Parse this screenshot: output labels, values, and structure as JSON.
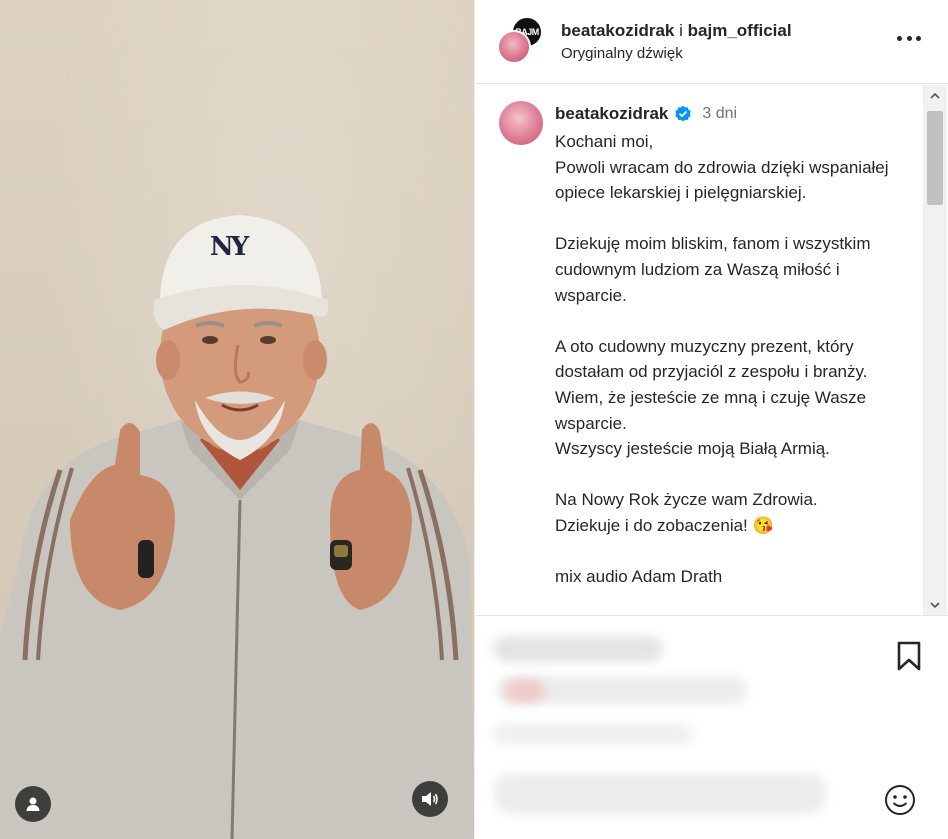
{
  "post": {
    "header": {
      "owner": "beatakozidrak",
      "separator": "i",
      "collaborator": "bajm_official",
      "audio": "Oryginalny dźwięk",
      "collab_avatar_text": "BAJM"
    },
    "caption": {
      "username": "beatakozidrak",
      "time": "3 dni",
      "text": "Kochani moi,\nPowoli wracam do zdrowia dzięki wspaniałej opiece lekarskiej i pielęgniarskiej.\n\nDziekuję moim bliskim, fanom i wszystkim cudownym ludziom za Waszą miłość i wsparcie.\n\nA oto cudowny muzyczny prezent, który dostałam od przyjaciól z zespołu i branży. Wiem, że jesteście ze mną i czuję Wasze wsparcie.\nWszyscy jesteście moją Białą Armią.\n\nNa Nowy Rok życze wam Zdrowia.\nDziekuje i do zobaczenia! 😘\n\nmix audio Adam Drath"
    },
    "media": {
      "cap_text": "NY"
    }
  },
  "icons": {
    "more": "more-horizontal-icon",
    "verified": "verified-badge-icon",
    "bookmark": "bookmark-icon",
    "emoji": "emoji-icon",
    "user_tag": "user-tag-icon",
    "audio": "speaker-icon",
    "scroll_up": "chevron-up-icon",
    "scroll_down": "chevron-down-icon"
  },
  "colors": {
    "verified": "#0095f6",
    "text": "#262626",
    "muted": "#737373"
  }
}
